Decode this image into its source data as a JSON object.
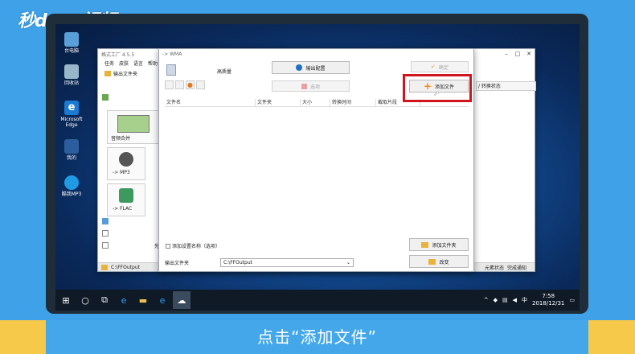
{
  "brand": {
    "logo_text": "秒dong视频"
  },
  "desktop": {
    "icons": [
      {
        "label": "台电脑"
      },
      {
        "label": "回收站"
      },
      {
        "label": "Microsoft Edge"
      },
      {
        "label": "我的"
      },
      {
        "label": "酷我MP3"
      }
    ]
  },
  "back_window": {
    "title": "格式工厂 4.5.5",
    "menu": [
      "任务",
      "皮肤",
      "语言",
      "帮助"
    ],
    "toolbar_output": "输出文件夹",
    "items": [
      {
        "label": "音频合并"
      },
      {
        "label": "-> MP3"
      },
      {
        "label": "-> FLAC"
      }
    ],
    "side_text": "先",
    "bottom_path": "C:\\FFOutput",
    "right_tab": "/ 转换状态",
    "status_right": [
      "元素状态",
      "完成通知"
    ]
  },
  "dialog": {
    "title": "-> WMA",
    "quality_label": "高质量",
    "output_config": "输出配置",
    "option_button": "选项",
    "ok_button": "确定",
    "add_file_button": "添加文件",
    "columns": [
      "文件名",
      "文件夹",
      "大小",
      "转换时间",
      "截取片段"
    ],
    "rename_checkbox": "添加设置名称（选项）",
    "add_folder_button": "添加文件夹",
    "output_label": "输出文件夹",
    "output_path": "C:\\FFOutput",
    "settings_button": "改变"
  },
  "taskbar": {
    "ime": "中",
    "time": "7:58",
    "date": "2018/12/31"
  },
  "caption": {
    "text": "点击“添加文件”"
  },
  "colors": {
    "highlight": "#d0161c",
    "caption_bg": "#44a7ea",
    "outer_bar": "#f7c94a"
  }
}
